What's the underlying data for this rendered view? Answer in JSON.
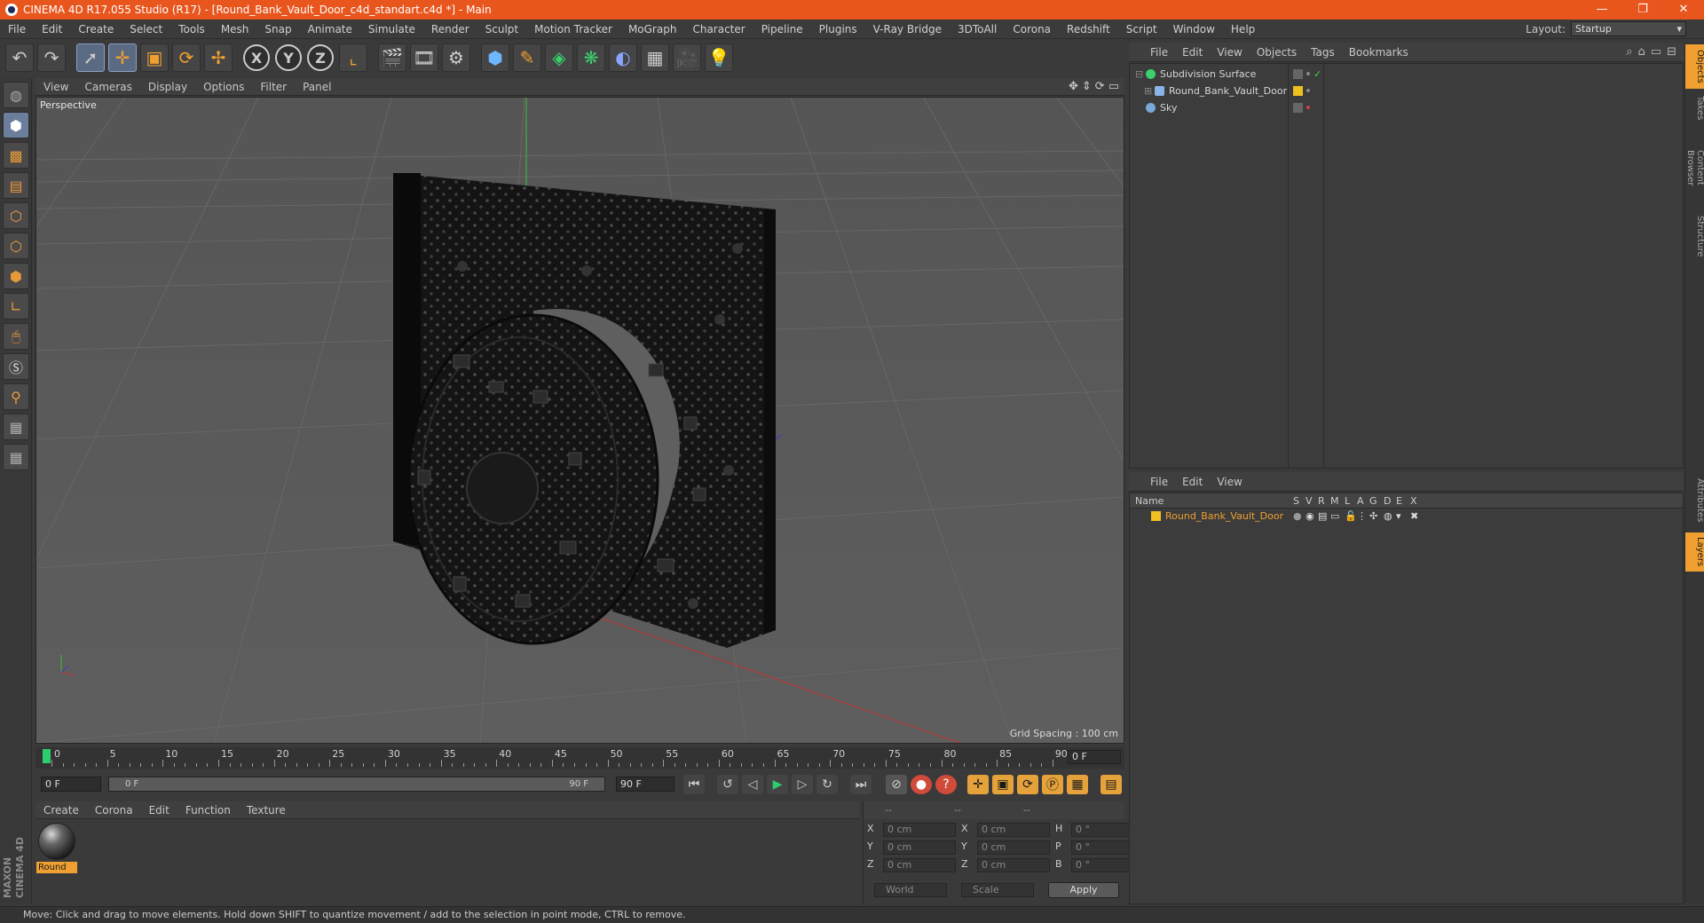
{
  "window": {
    "title": "CINEMA 4D R17.055 Studio (R17) - [Round_Bank_Vault_Door_c4d_standart.c4d *] - Main",
    "controls": [
      "—",
      "❐",
      "✕"
    ]
  },
  "menubar": {
    "items": [
      "File",
      "Edit",
      "Create",
      "Select",
      "Tools",
      "Mesh",
      "Snap",
      "Animate",
      "Simulate",
      "Render",
      "Sculpt",
      "Motion Tracker",
      "MoGraph",
      "Character",
      "Pipeline",
      "Plugins",
      "V-Ray Bridge",
      "3DToAll",
      "Corona",
      "Redshift",
      "Script",
      "Window",
      "Help"
    ],
    "layout_label": "Layout:",
    "layout_value": "Startup"
  },
  "toolbar": {
    "axis_labels": [
      "X",
      "Y",
      "Z"
    ]
  },
  "viewport": {
    "menu": [
      "View",
      "Cameras",
      "Display",
      "Options",
      "Filter",
      "Panel"
    ],
    "label": "Perspective",
    "grid_spacing": "Grid Spacing : 100 cm",
    "nav_icons": [
      "✥",
      "⇕",
      "⟳",
      "▭"
    ]
  },
  "timeline": {
    "ticks": [
      "0",
      "5",
      "10",
      "15",
      "20",
      "25",
      "30",
      "35",
      "40",
      "45",
      "50",
      "55",
      "60",
      "65",
      "70",
      "75",
      "80",
      "85",
      "90"
    ],
    "end_frame": "0 F",
    "current": "0 F",
    "range_start": "0 F",
    "range_end": "90 F",
    "max": "90 F"
  },
  "material_manager": {
    "menu": [
      "Create",
      "Corona",
      "Edit",
      "Function",
      "Texture"
    ],
    "material_name": "Round"
  },
  "coordinates": {
    "headers": [
      "--",
      "--",
      "--"
    ],
    "rows": [
      {
        "a": "X",
        "av": "0 cm",
        "b": "X",
        "bv": "0 cm",
        "c": "H",
        "cv": "0 °"
      },
      {
        "a": "Y",
        "av": "0 cm",
        "b": "Y",
        "bv": "0 cm",
        "c": "P",
        "cv": "0 °"
      },
      {
        "a": "Z",
        "av": "0 cm",
        "b": "Z",
        "bv": "0 cm",
        "c": "B",
        "cv": "0 °"
      }
    ],
    "mode": "World",
    "transform": "Scale",
    "apply": "Apply"
  },
  "status": "Move: Click and drag to move elements. Hold down SHIFT to quantize movement / add to the selection in point mode, CTRL to remove.",
  "object_manager": {
    "menu": [
      "File",
      "Edit",
      "View",
      "Objects",
      "Tags",
      "Bookmarks"
    ],
    "objects": [
      {
        "name": "Subdivision Surface",
        "icon_color": "#3bcf6d"
      },
      {
        "name": "Round_Bank_Vault_Door",
        "icon_color": "#8ab4e8"
      },
      {
        "name": "Sky",
        "icon_color": "#7aa8d8"
      }
    ]
  },
  "layer_manager": {
    "menu": [
      "File",
      "Edit",
      "View"
    ],
    "columns": [
      "Name",
      "S",
      "V",
      "R",
      "M",
      "L",
      "A",
      "G",
      "D",
      "E",
      "X"
    ],
    "layer_name": "Round_Bank_Vault_Door",
    "layer_color": "#f0c020"
  },
  "side_tabs": [
    "Objects",
    "Takes",
    "Content Browser",
    "Structure",
    "Attributes",
    "Layers"
  ],
  "colors": {
    "title_bar": "#e8561d",
    "accent_orange": "#f0a030",
    "active_blue": "#5a6a82"
  }
}
